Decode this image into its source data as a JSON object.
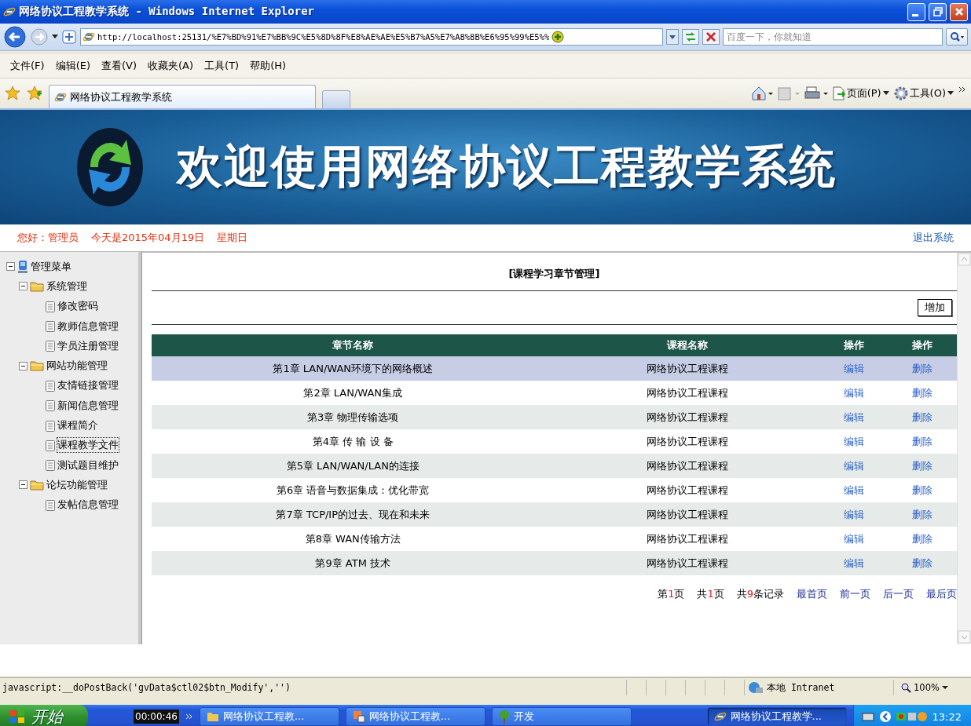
{
  "window": {
    "title": "网络协议工程教学系统 - Windows Internet Explorer"
  },
  "address": {
    "url": "http://localhost:25131/%E7%BD%91%E7%BB%9C%E5%8D%8F%E8%AE%AE%E5%B7%A5%E7%A8%8B%E6%95%99%E5%%",
    "search_placeholder": "百度一下，你就知道"
  },
  "menu": [
    "文件(F)",
    "编辑(E)",
    "查看(V)",
    "收藏夹(A)",
    "工具(T)",
    "帮助(H)"
  ],
  "tab": {
    "title": "网络协议工程教学系统"
  },
  "commands": [
    "页面(P)",
    "工具(O)"
  ],
  "banner": {
    "title": "欢迎使用网络协议工程教学系统"
  },
  "greeting": {
    "user": "您好：管理员",
    "date": "今天是2015年04月19日",
    "weekday": "星期日",
    "logout": "退出系统"
  },
  "tree": {
    "label": "管理菜单",
    "expanded": true,
    "children": [
      {
        "label": "系统管理",
        "expanded": true,
        "children": [
          {
            "label": "修改密码",
            "selected": false
          },
          {
            "label": "教师信息管理",
            "selected": false
          },
          {
            "label": "学员注册管理",
            "selected": false
          }
        ]
      },
      {
        "label": "网站功能管理",
        "expanded": true,
        "children": [
          {
            "label": "友情链接管理",
            "selected": false
          },
          {
            "label": "新闻信息管理",
            "selected": false
          },
          {
            "label": "课程简介",
            "selected": false
          },
          {
            "label": "课程教学文件",
            "selected": true
          },
          {
            "label": "测试题目维护",
            "selected": false
          }
        ]
      },
      {
        "label": "论坛功能管理",
        "expanded": true,
        "children": [
          {
            "label": "发帖信息管理",
            "selected": false
          }
        ]
      }
    ]
  },
  "main": {
    "heading": "[课程学习章节管理]",
    "add_button": "增加",
    "columns": [
      "章节名称",
      "课程名称",
      "操作",
      "操作"
    ],
    "rows": [
      {
        "chapter": "第1章 LAN/WAN环境下的网络概述",
        "course": "网络协议工程课程",
        "edit": "编辑",
        "delete": "删除",
        "selected": true
      },
      {
        "chapter": "第2章 LAN/WAN集成",
        "course": "网络协议工程课程",
        "edit": "编辑",
        "delete": "删除",
        "selected": false
      },
      {
        "chapter": "第3章 物理传输选项",
        "course": "网络协议工程课程",
        "edit": "编辑",
        "delete": "删除",
        "selected": false
      },
      {
        "chapter": "第4章 传 输 设 备",
        "course": "网络协议工程课程",
        "edit": "编辑",
        "delete": "删除",
        "selected": false
      },
      {
        "chapter": "第5章 LAN/WAN/LAN的连接",
        "course": "网络协议工程课程",
        "edit": "编辑",
        "delete": "删除",
        "selected": false
      },
      {
        "chapter": "第6章 语音与数据集成：优化带宽",
        "course": "网络协议工程课程",
        "edit": "编辑",
        "delete": "删除",
        "selected": false
      },
      {
        "chapter": "第7章 TCP/IP的过去、现在和未来",
        "course": "网络协议工程课程",
        "edit": "编辑",
        "delete": "删除",
        "selected": false
      },
      {
        "chapter": "第8章 WAN传输方法",
        "course": "网络协议工程课程",
        "edit": "编辑",
        "delete": "删除",
        "selected": false
      },
      {
        "chapter": "第9章 ATM 技术",
        "course": "网络协议工程课程",
        "edit": "编辑",
        "delete": "删除",
        "selected": false
      }
    ],
    "pager_info": [
      {
        "prefix": "第",
        "number": "1",
        "suffix": "页"
      },
      {
        "prefix": "共",
        "number": "1",
        "suffix": "页"
      },
      {
        "prefix": "共",
        "number": "9",
        "suffix": "条记录"
      }
    ],
    "pager_links": [
      "最首页",
      "前一页",
      "后一页",
      "最后页"
    ]
  },
  "status_bar": {
    "text": "javascript:__doPostBack('gvData$ctl02$btn_Modify','')",
    "zone": "本地 Intranet",
    "zoom": "100%"
  },
  "taskbar": {
    "start": "开始",
    "timer": "00:00:46",
    "buttons": [
      {
        "label": "网络协议工程教...",
        "kind": "folder",
        "selected": false
      },
      {
        "label": "网络协议工程教...",
        "kind": "app",
        "selected": false
      },
      {
        "label": "开发",
        "kind": "tree",
        "selected": false
      },
      {
        "label": "网络协议工程教学...",
        "kind": "browser",
        "selected": true
      }
    ],
    "clock": "13:22"
  }
}
